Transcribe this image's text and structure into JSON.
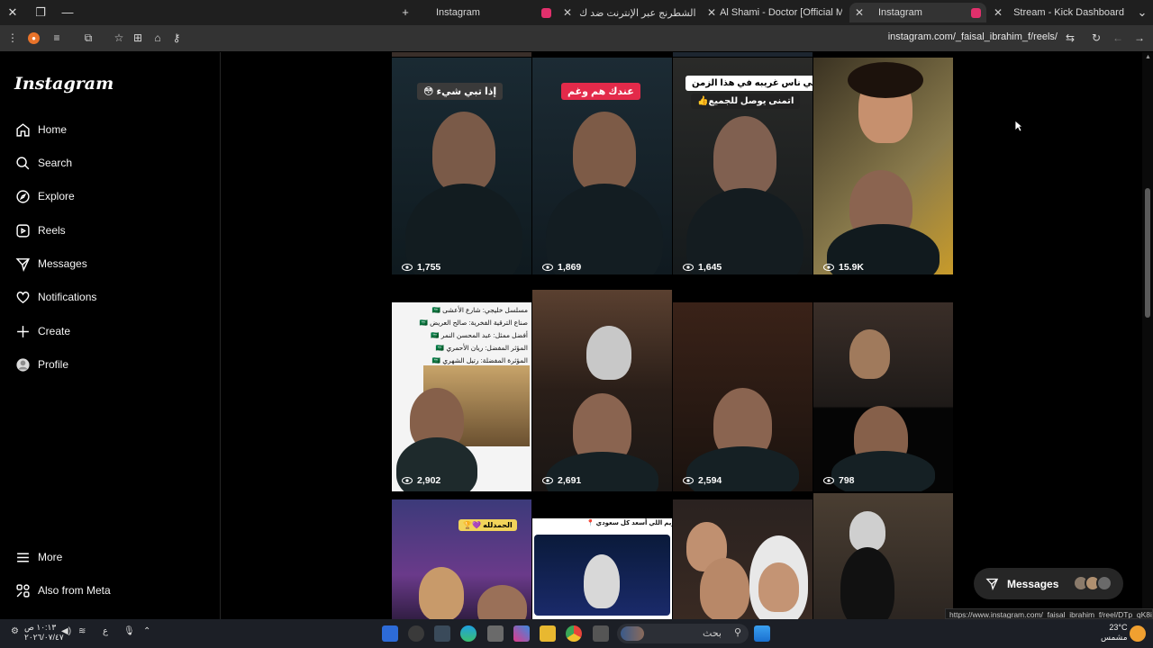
{
  "browser": {
    "tabs": [
      {
        "title": "Instagram",
        "color": "#e1306c",
        "active": false
      },
      {
        "title": "إلعب الشطرنج عبر الإنترنت ضد ك",
        "color": "#7fa650",
        "active": false
      },
      {
        "title": "Al Shami - Doctor [Official Mus",
        "color": "#ff0000",
        "active": false
      },
      {
        "title": "Instagram",
        "color": "#e1306c",
        "active": true
      },
      {
        "title": "Stream - Kick Dashboard",
        "color": "#53fc18",
        "active": false
      }
    ],
    "url": "instagram.com/_faisal_ibrahim_f/reels/",
    "status_url": "https://www.instagram.com/_faisal_ibrahim_f/reel/DTp_qK8iLqo/"
  },
  "instagram": {
    "logo": "Instagram",
    "nav": [
      {
        "label": "Home",
        "icon": "home-icon"
      },
      {
        "label": "Search",
        "icon": "search-icon"
      },
      {
        "label": "Explore",
        "icon": "explore-icon"
      },
      {
        "label": "Reels",
        "icon": "reels-icon"
      },
      {
        "label": "Messages",
        "icon": "messages-icon"
      },
      {
        "label": "Notifications",
        "icon": "heart-icon"
      },
      {
        "label": "Create",
        "icon": "plus-icon"
      },
      {
        "label": "Profile",
        "icon": "profile-icon"
      }
    ],
    "bottom_nav": [
      {
        "label": "More",
        "icon": "menu-icon"
      },
      {
        "label": "Also from Meta",
        "icon": "meta-icon"
      }
    ],
    "reels": [
      {
        "views": "1,755",
        "caption": "إذا تبي شيء 😳"
      },
      {
        "views": "1,869",
        "caption": "عندك هم وغم"
      },
      {
        "views": "1,645",
        "caption": "في ناس غريبه في هذا الزمن",
        "caption2": "اتمنى يوصل للجميع👍"
      },
      {
        "views": "15.9K",
        "caption": ""
      },
      {
        "views": "2,902",
        "caption": "",
        "lines": [
          "مسلسل خليجي: شارع الأعشى 🇸🇦",
          "صناع الترقية الفخرية: صالح العريض 🇸🇦",
          "أفضل ممثل: عبد المحسن النمر 🇸🇦",
          "المؤثر المفضل: ريان الأحمري 🇸🇦",
          "المؤثرة المفضلة: رتيل الشهري 🇸🇦"
        ]
      },
      {
        "views": "2,691",
        "caption": ""
      },
      {
        "views": "2,594",
        "caption": ""
      },
      {
        "views": "798",
        "caption": ""
      },
      {
        "views": "",
        "caption": "الحمدلله 💜🏆"
      },
      {
        "views": "",
        "caption": "التكريم اللي أسعد كل سعودي 📍"
      },
      {
        "views": "",
        "caption": ""
      },
      {
        "views": "",
        "caption": ""
      }
    ],
    "messages_label": "Messages"
  },
  "taskbar": {
    "search_placeholder": "بحث",
    "time": "١٠:١٣ ص",
    "date": "٢٠٢٦/٠٧/٤٧",
    "lang": "ع",
    "temp": "23°C",
    "weather": "مشمس"
  }
}
